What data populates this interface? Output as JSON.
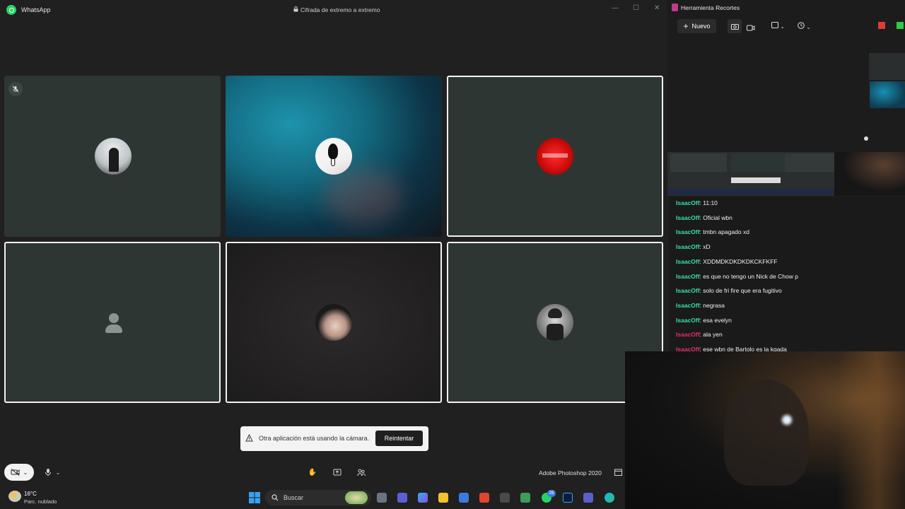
{
  "whatsapp": {
    "app_name": "WhatsApp",
    "encryption_label": "Cifrada de extremo a extremo",
    "toast": {
      "message": "Otra aplicación está usando la cámara.",
      "button": "Reintentar"
    },
    "taskbar_app_label": "Adobe Photoshop 2020"
  },
  "snipping_tool": {
    "title": "Herramienta Recortes",
    "new_button": "Nuevo"
  },
  "chat": {
    "user_color": "#38e0a2",
    "user_color_alt": "#e0306a",
    "messages": [
      {
        "user": "IsaacOff",
        "text": ": 11:10"
      },
      {
        "user": "IsaacOff",
        "text": ": Oficial wbn"
      },
      {
        "user": "IsaacOff",
        "text": ": tmbn apagado xd"
      },
      {
        "user": "IsaacOff",
        "text": ": xD"
      },
      {
        "user": "IsaacOff",
        "text": ": XDDMDKDKDKDKCKFKFF"
      },
      {
        "user": "IsaacOff",
        "text": ": es que no tengo un Nick de Chow p"
      },
      {
        "user": "IsaacOff",
        "text": ": solo de fri fire que era fugitivo"
      },
      {
        "user": "IsaacOff",
        "text": ": negrasa"
      },
      {
        "user": "IsaacOff",
        "text": ": esa evelyn"
      },
      {
        "user": "IsaacOff",
        "text": ": ala yen"
      },
      {
        "user": "IsaacOff",
        "text": ": ese wbn de Bartolo es la kgada"
      }
    ]
  },
  "taskbar": {
    "weather_temp": "16°C",
    "weather_desc": "Parc. nublado",
    "search_placeholder": "Buscar",
    "whatsapp_badge": "28"
  }
}
